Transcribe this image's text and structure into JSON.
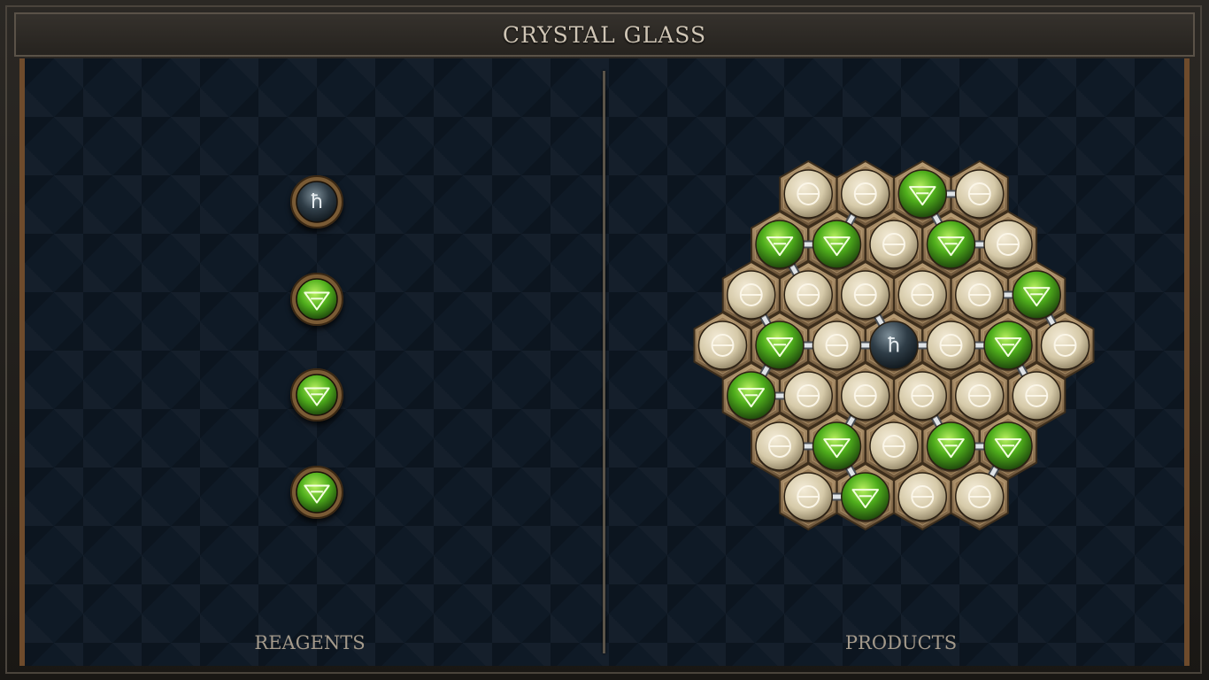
{
  "title": "CRYSTAL GLASS",
  "labels": {
    "reagents": "REAGENTS",
    "products": "PRODUCTS"
  },
  "colors": {
    "board": "#0f1a26",
    "frame": "#2b2824",
    "accent_copper": "#6e4b2c",
    "earth_green": "#5fbf2a",
    "salt_white": "#e0d6bd",
    "lead_dark": "#2c3a45"
  },
  "elements": {
    "salt": {
      "icon": "salt-icon",
      "symbol": "⊖"
    },
    "earth": {
      "icon": "earth-icon",
      "symbol": "🜃"
    },
    "lead": {
      "icon": "lead-icon",
      "symbol": "♄"
    }
  },
  "reagents": [
    "lead",
    "earth",
    "earth",
    "earth"
  ],
  "products": {
    "rows": [
      [
        "salt",
        "salt",
        "earth",
        "salt"
      ],
      [
        "earth",
        "earth",
        "salt",
        "earth",
        "salt"
      ],
      [
        "salt",
        "salt",
        "salt",
        "salt",
        "salt",
        "earth"
      ],
      [
        "salt",
        "earth",
        "salt",
        "lead",
        "salt",
        "earth",
        "salt"
      ],
      [
        "earth",
        "salt",
        "salt",
        "salt",
        "salt",
        "salt"
      ],
      [
        "salt",
        "earth",
        "salt",
        "earth",
        "earth"
      ],
      [
        "salt",
        "earth",
        "salt",
        "salt"
      ]
    ],
    "bonds": [
      [
        [
          0,
          2
        ],
        [
          0,
          3
        ]
      ],
      [
        [
          0,
          1
        ],
        [
          1,
          1
        ]
      ],
      [
        [
          0,
          2
        ],
        [
          1,
          3
        ]
      ],
      [
        [
          1,
          0
        ],
        [
          1,
          1
        ]
      ],
      [
        [
          1,
          0
        ],
        [
          2,
          1
        ]
      ],
      [
        [
          1,
          3
        ],
        [
          1,
          4
        ]
      ],
      [
        [
          2,
          4
        ],
        [
          2,
          5
        ]
      ],
      [
        [
          2,
          5
        ],
        [
          3,
          6
        ]
      ],
      [
        [
          2,
          2
        ],
        [
          3,
          3
        ]
      ],
      [
        [
          2,
          0
        ],
        [
          3,
          1
        ]
      ],
      [
        [
          3,
          1
        ],
        [
          3,
          2
        ]
      ],
      [
        [
          3,
          2
        ],
        [
          3,
          3
        ]
      ],
      [
        [
          3,
          3
        ],
        [
          3,
          4
        ]
      ],
      [
        [
          3,
          4
        ],
        [
          3,
          5
        ]
      ],
      [
        [
          3,
          5
        ],
        [
          4,
          5
        ]
      ],
      [
        [
          3,
          1
        ],
        [
          4,
          0
        ]
      ],
      [
        [
          4,
          0
        ],
        [
          4,
          1
        ]
      ],
      [
        [
          4,
          2
        ],
        [
          5,
          1
        ]
      ],
      [
        [
          4,
          3
        ],
        [
          5,
          3
        ]
      ],
      [
        [
          5,
          3
        ],
        [
          5,
          4
        ]
      ],
      [
        [
          5,
          0
        ],
        [
          5,
          1
        ]
      ],
      [
        [
          5,
          1
        ],
        [
          6,
          1
        ]
      ],
      [
        [
          5,
          4
        ],
        [
          6,
          3
        ]
      ],
      [
        [
          6,
          0
        ],
        [
          6,
          1
        ]
      ]
    ]
  }
}
